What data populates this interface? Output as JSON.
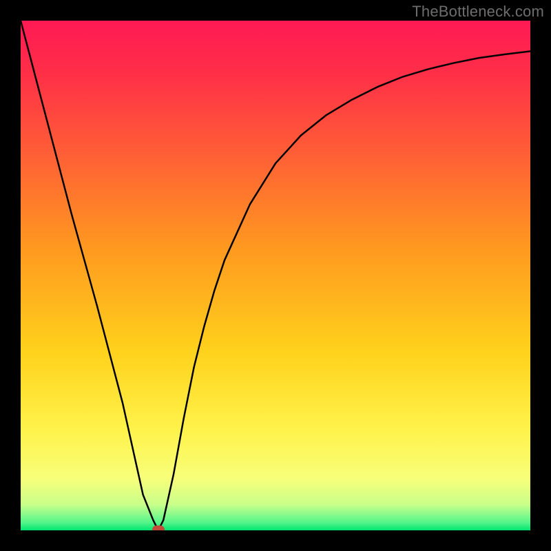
{
  "watermark": "TheBottleneck.com",
  "colors": {
    "frame": "#000000",
    "gradient_stops": [
      {
        "pos": 0.0,
        "color": "#ff1a53"
      },
      {
        "pos": 0.1,
        "color": "#ff2e48"
      },
      {
        "pos": 0.25,
        "color": "#ff5b37"
      },
      {
        "pos": 0.45,
        "color": "#ff9a1f"
      },
      {
        "pos": 0.65,
        "color": "#ffd21c"
      },
      {
        "pos": 0.8,
        "color": "#fff24a"
      },
      {
        "pos": 0.9,
        "color": "#f7ff7a"
      },
      {
        "pos": 0.95,
        "color": "#c8ff8a"
      },
      {
        "pos": 0.985,
        "color": "#52f58b"
      },
      {
        "pos": 1.0,
        "color": "#00e56f"
      }
    ],
    "curve": "#000000",
    "marker": "#c44a3a"
  },
  "chart_data": {
    "type": "line",
    "title": "",
    "xlabel": "",
    "ylabel": "",
    "xlim": [
      0,
      100
    ],
    "ylim": [
      0,
      100
    ],
    "grid": false,
    "series": [
      {
        "name": "bottleneck-curve",
        "x": [
          0,
          5,
          10,
          15,
          20,
          24,
          26,
          27,
          28,
          30,
          32,
          34,
          36,
          38,
          40,
          45,
          50,
          55,
          60,
          65,
          70,
          75,
          80,
          85,
          90,
          95,
          100
        ],
        "y": [
          100,
          81,
          62,
          44,
          25,
          7,
          2,
          0,
          2,
          11,
          22,
          32,
          40,
          47,
          53,
          64,
          72,
          77.5,
          81.5,
          84.5,
          87,
          89,
          90.5,
          91.7,
          92.7,
          93.4,
          94
        ]
      }
    ],
    "marker": {
      "x": 27,
      "y": 0
    },
    "legend": false
  }
}
